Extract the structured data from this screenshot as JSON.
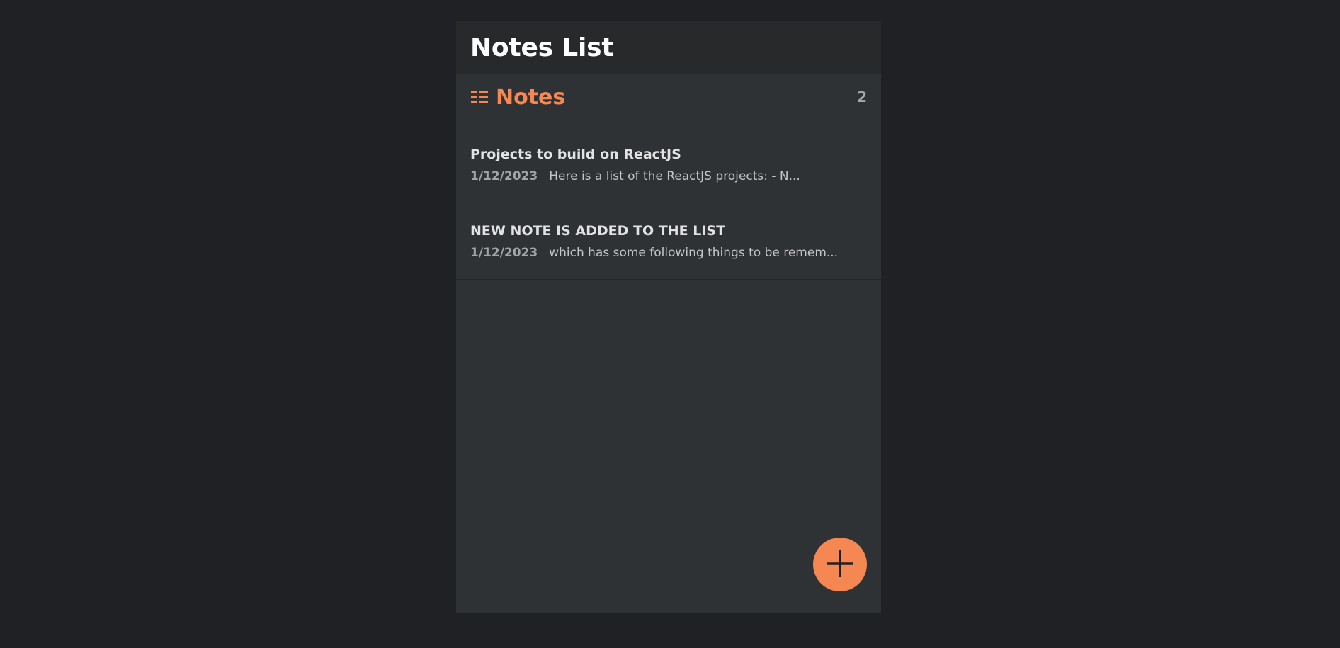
{
  "app": {
    "title": "Notes List"
  },
  "notes_section": {
    "label": "Notes",
    "count": "2",
    "icon": "list-icon"
  },
  "notes": [
    {
      "title": "Projects to build on ReactJS",
      "date": "1/12/2023",
      "preview": "Here is a list of the ReactJS projects: - N..."
    },
    {
      "title": "NEW NOTE IS ADDED TO THE LIST",
      "date": "1/12/2023",
      "preview": "which has some following things to be remem..."
    }
  ],
  "fab": {
    "icon": "plus-icon"
  },
  "colors": {
    "accent": "#f58752",
    "background": "#202125",
    "panel": "#2f3235",
    "header": "#27292b"
  }
}
